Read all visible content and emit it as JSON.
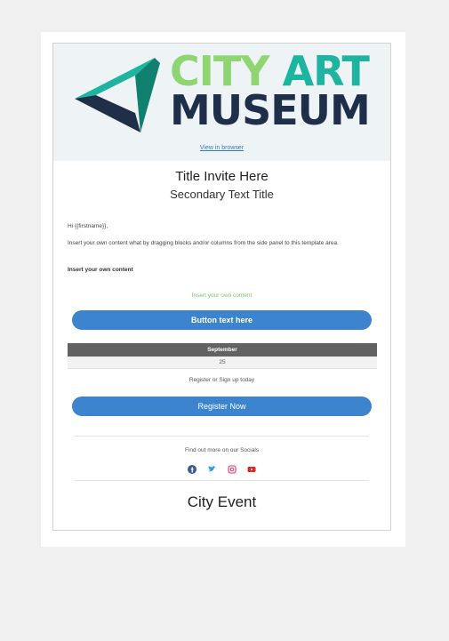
{
  "header": {
    "logo_line1_a": "CITY",
    "logo_line1_b": "ART",
    "logo_line2": "MUSEUM",
    "view_in_browser": "View in browser"
  },
  "invite": {
    "title": "Title Invite Here",
    "subtitle": "Secondary Text Title",
    "greeting": "Hi {{firstname}},",
    "body": "Insert your own content what by dragging blocks and/or columns from the side panel to this template area.",
    "bold_line": "Insert your own content",
    "accent_text": "Insert your own content",
    "button_label": "Button text here"
  },
  "event_table": {
    "header": "September",
    "value": "25"
  },
  "register": {
    "prompt": "Register or Sign up today",
    "button_label": "Register Now"
  },
  "socials": {
    "label": "Find out more on our Socials",
    "icons": [
      "facebook-icon",
      "twitter-icon",
      "instagram-icon",
      "youtube-icon"
    ]
  },
  "footer": {
    "title": "City Event"
  },
  "colors": {
    "brand_green": "#8fd672",
    "brand_teal": "#1eb5a0",
    "brand_navy": "#1f2f4a",
    "button_blue": "#3d84cf",
    "table_header": "#626262"
  }
}
